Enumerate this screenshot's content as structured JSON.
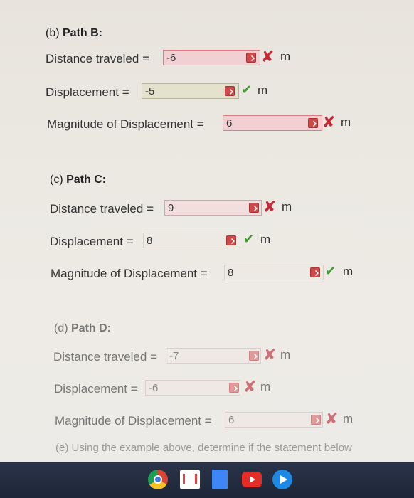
{
  "path_b": {
    "title_prefix": "(b) ",
    "title_bold": "Path B:",
    "distance": {
      "label": "Distance traveled =",
      "value": "-6",
      "status": "incorrect",
      "mark": "✘",
      "unit": "m"
    },
    "displacement": {
      "label": "Displacement =",
      "value": "-5",
      "status": "correct",
      "mark": "✔",
      "unit": "m"
    },
    "magnitude": {
      "label": "Magnitude of Displacement =",
      "value": "6",
      "status": "incorrect",
      "mark": "✘",
      "unit": "m"
    }
  },
  "path_c": {
    "title_prefix": "(c) ",
    "title_bold": "Path C:",
    "distance": {
      "label": "Distance traveled =",
      "value": "9",
      "status": "incorrect",
      "mark": "✘",
      "unit": "m"
    },
    "displacement": {
      "label": "Displacement =",
      "value": "8",
      "status": "correct",
      "mark": "✔",
      "unit": "m"
    },
    "magnitude": {
      "label": "Magnitude of Displacement =",
      "value": "8",
      "status": "correct",
      "mark": "✔",
      "unit": "m"
    }
  },
  "path_d": {
    "title_prefix": "(d) ",
    "title_bold": "Path D:",
    "distance": {
      "label": "Distance traveled =",
      "value": "-7",
      "status": "incorrect",
      "mark": "✘",
      "unit": "m"
    },
    "displacement": {
      "label": "Displacement =",
      "value": "-6",
      "status": "incorrect",
      "mark": "✘",
      "unit": "m"
    },
    "magnitude": {
      "label": "Magnitude of Displacement =",
      "value": "6",
      "status": "incorrect",
      "mark": "✘",
      "unit": "m"
    }
  },
  "part_e_text": "(e) Using the example above, determine if the statement below",
  "colors": {
    "correct": "#3f9b2e",
    "incorrect": "#c62835",
    "taskbar": "#232c40"
  },
  "taskbar_icons": [
    "chrome-icon",
    "gmail-icon",
    "docs-icon",
    "youtube-icon",
    "play-icon"
  ]
}
